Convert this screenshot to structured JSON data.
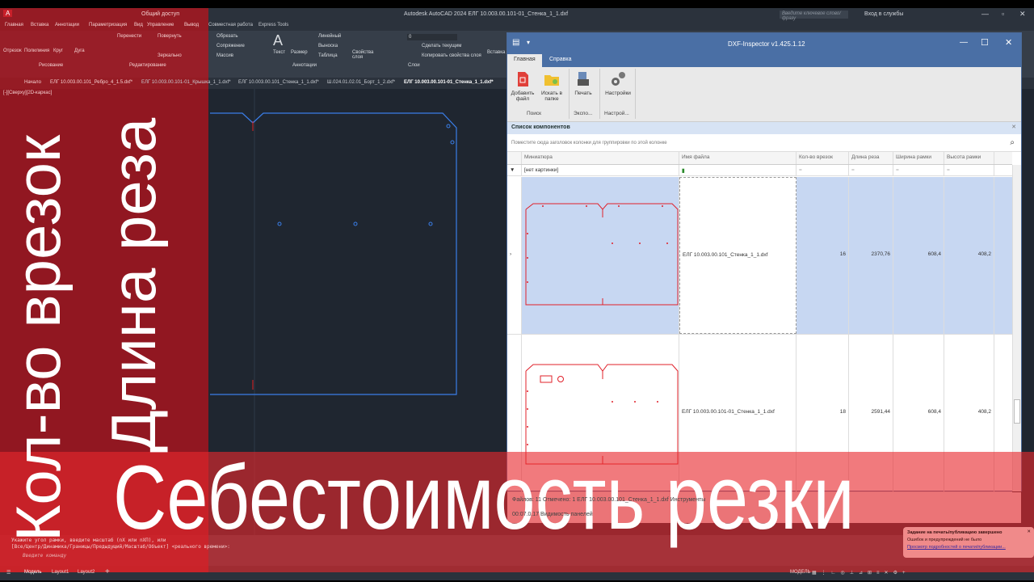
{
  "acad": {
    "title": "Autodesk AutoCAD 2024   ЕЛГ 10.003.00.101-01_Стенка_1_1.dxf",
    "search_placeholder": "Введите ключевое слово/фразу",
    "login": "Вход в службы",
    "quick_access": "Общий доступ",
    "menu": [
      "Главная",
      "Вставка",
      "Аннотации",
      "Параметризация",
      "Вид",
      "Управление",
      "Вывод",
      "Совместная работа",
      "Express Tools"
    ],
    "ribbon": {
      "draw": [
        "Отрезок",
        "Полилиния",
        "Круг",
        "Дуга"
      ],
      "draw_group": "Рисование",
      "modify": [
        "Перенести",
        "Повернуть",
        "Обрезать",
        "Сопряжение",
        "Массив",
        "Зеркально"
      ],
      "modify_group": "Редактирование",
      "annot": [
        "Текст",
        "Размер",
        "Линейный",
        "Выноска",
        "Таблица"
      ],
      "annot_group": "Аннотации",
      "layers": [
        "Свойства слоя",
        "Сделать текущим",
        "Копировать свойства слоя"
      ],
      "layer_value": "0",
      "layers_group": "Слои",
      "insert": "Вставка"
    },
    "doc_tabs": [
      "Начало",
      "ЕЛГ 10.003.00.101_Ребро_4_1.5.dxf*",
      "ЕЛГ 10.003.00.101-01_Крышка_1_1.dxf*",
      "ЕЛГ 10.003.00.101_Стенка_1_1.dxf*",
      "Ш.024.01.02.01_Борт_1_2.dxf*",
      "ЕЛГ 10.003.00.101-01_Стенка_1_1.dxf*"
    ],
    "viewport_label": "[-][Сверху][2D-каркас]",
    "cmd_lines": [
      "Укажите угол рамки, введите масштаб (nX или nXП), или",
      "[Все/Центр/Динамика/Границы/Предыдущий/Масштаб/Объект] <реального времени>:"
    ],
    "cmd_placeholder": "Введите команду",
    "layouts": [
      "Модель",
      "Layout1",
      "Layout2"
    ],
    "status_model": "МОДЕЛЬ",
    "toast": {
      "title": "Задание на печать/публикацию завершено",
      "line": "Ошибок и предупреждений не было",
      "link": "Просмотр подробностей о печати/публикации..."
    }
  },
  "inspector": {
    "title": "DXF-Inspector v1.425.1.12",
    "tabs": [
      "Главная",
      "Справка"
    ],
    "buttons": {
      "add": "Добавить файл",
      "search": "Искать в папке",
      "print": "Печать",
      "settings": "Настройки"
    },
    "groups": {
      "search": "Поиск",
      "export": "Экспо...",
      "settings": "Настрой..."
    },
    "panel_title": "Список компонентов",
    "group_hint": "Поместите сюда заголовок колонки для группировки по этой колонке",
    "columns": [
      "Миниатюра",
      "Имя файла",
      "Кол-во врезок",
      "Длина реза",
      "Ширина рамки",
      "Высота рамки"
    ],
    "filter": {
      "thumb": "[нет картинки]",
      "eq": "="
    },
    "rows": [
      {
        "file": "ЕЛГ 10.003.00.101_Стенка_1_1.dxf",
        "pierces": "16",
        "cut_length": "2370,76",
        "width": "608,4",
        "height": "408,2",
        "selected": true
      },
      {
        "file": "ЕЛГ 10.003.00.101-01_Стенка_1_1.dxf",
        "pierces": "18",
        "cut_length": "2591,44",
        "width": "608,4",
        "height": "408,2",
        "selected": false
      }
    ],
    "status": {
      "line1": "Файлов: 11   Отмечено: 1   ЕЛГ 10.003.00.101_Стенка_1_1.dxf   Инструменты",
      "line2": "00:07.0.17   Видимость панелей"
    }
  },
  "overlay": {
    "vertical1": "Кол-во врезок",
    "vertical2": "Длина реза",
    "headline": "Себестоимость резки"
  },
  "colors": {
    "overlay_red": "#c0121c",
    "inspector_blue": "#4a6fa5",
    "selected_row": "#c7d7f2",
    "part_line": "#e0202a"
  }
}
